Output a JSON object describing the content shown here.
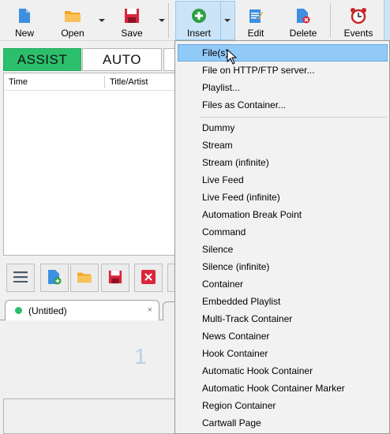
{
  "toolbar": {
    "new_label": "New",
    "open_label": "Open",
    "save_label": "Save",
    "insert_label": "Insert",
    "edit_label": "Edit",
    "delete_label": "Delete",
    "events_label": "Events"
  },
  "modes": {
    "assist": "ASSIST",
    "auto": "AUTO"
  },
  "grid": {
    "columns": [
      "Time",
      "Title/Artist"
    ]
  },
  "tab": {
    "title": "(Untitled)",
    "close": "×"
  },
  "counter": "1",
  "insert_menu": {
    "items": [
      "File(s)",
      "File on HTTP/FTP server...",
      "Playlist...",
      "Files as Container...",
      "Dummy",
      "Stream",
      "Stream (infinite)",
      "Live Feed",
      "Live Feed (infinite)",
      "Automation Break Point",
      "Command",
      "Silence",
      "Silence (infinite)",
      "Container",
      "Embedded Playlist",
      "Multi-Track Container",
      "News Container",
      "Hook Container",
      "Automatic Hook Container",
      "Automatic Hook Container Marker",
      "Region Container",
      "Cartwall Page"
    ],
    "highlighted": "File(s)"
  },
  "colors": {
    "assist_green": "#2bbf6b",
    "menu_highlight": "#91c9f7",
    "toolbar_active": "#cce4f7"
  }
}
